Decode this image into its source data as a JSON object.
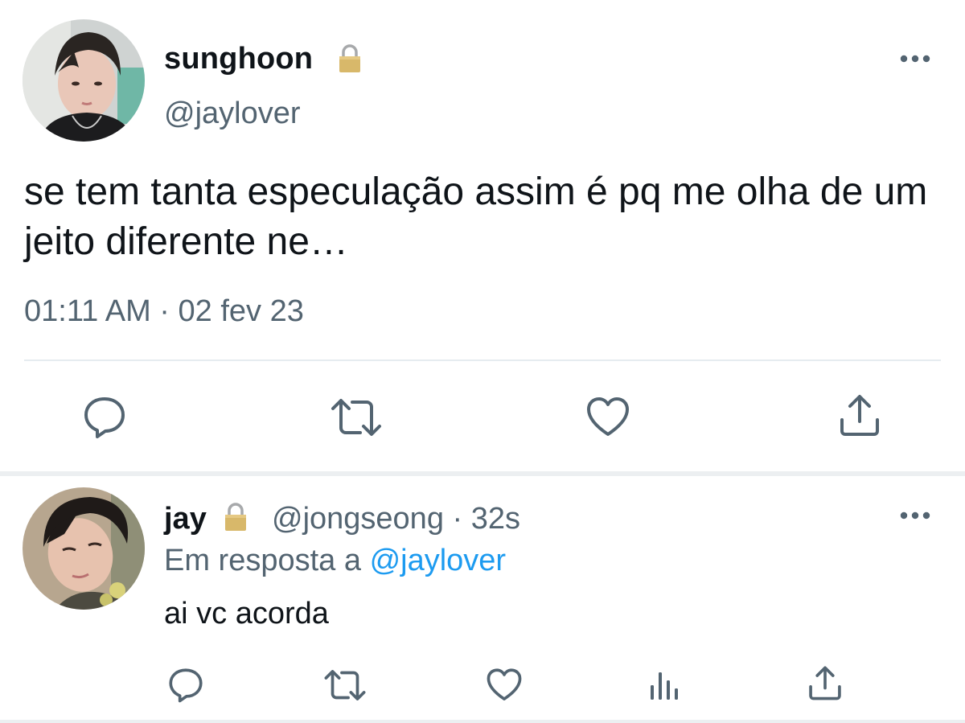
{
  "main_tweet": {
    "author": {
      "name": "sunghoon",
      "handle": "@jaylover",
      "protected_icon": "lock-icon"
    },
    "text": "se tem tanta especulação assim é pq me olha de um jeito diferente ne…",
    "timestamp": "01:11 AM · 02 fev 23",
    "actions": [
      "reply-icon",
      "retweet-icon",
      "like-icon",
      "share-icon"
    ]
  },
  "reply_tweet": {
    "author": {
      "name": "jay",
      "protected_icon": "lock-icon"
    },
    "handle_time": "@jongseong · 32s",
    "in_reply_prefix": "Em resposta a",
    "in_reply_mention": "@jaylover",
    "text": "ai vc acorda",
    "actions": [
      "reply-icon",
      "retweet-icon",
      "like-icon",
      "analytics-icon",
      "share-icon"
    ]
  },
  "colors": {
    "text_primary": "#0f1419",
    "text_secondary": "#536471",
    "mention": "#1d9bf0",
    "divider": "#e6ecf0",
    "icon": "#536471"
  }
}
